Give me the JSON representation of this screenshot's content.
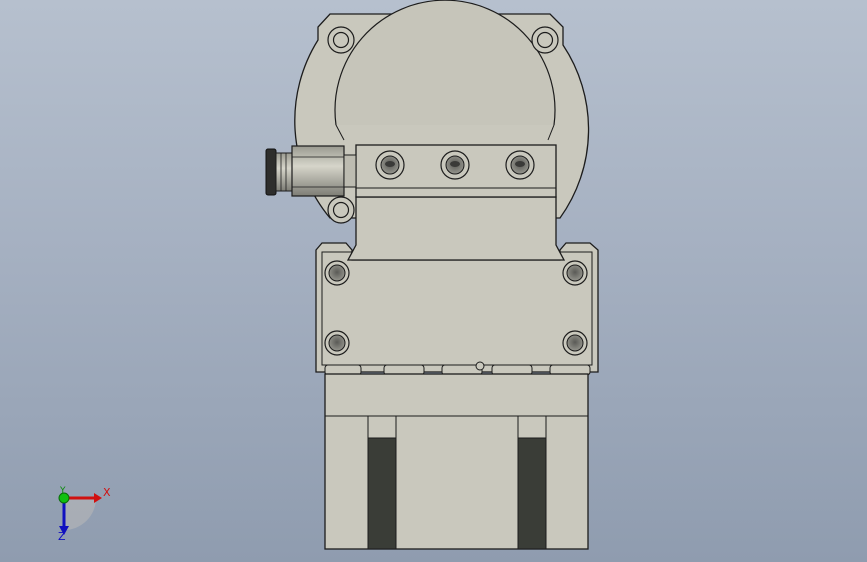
{
  "viewport": {
    "background_top": "#b6c0ce",
    "background_bottom": "#8f9caf",
    "part_face_color": "#c9c8bd",
    "part_edge_color": "#1c1c1c"
  },
  "model": {
    "description_icon": "cad-part-front-view",
    "features": [
      "flange",
      "top-block",
      "air-fitting",
      "body-block",
      "jaw-base",
      "jaws"
    ]
  },
  "triad": {
    "x_label": "X",
    "y_label": "Y",
    "z_label": "Z",
    "x_color": "#d01010",
    "y_color": "#10a010",
    "z_color": "#1010c0"
  }
}
